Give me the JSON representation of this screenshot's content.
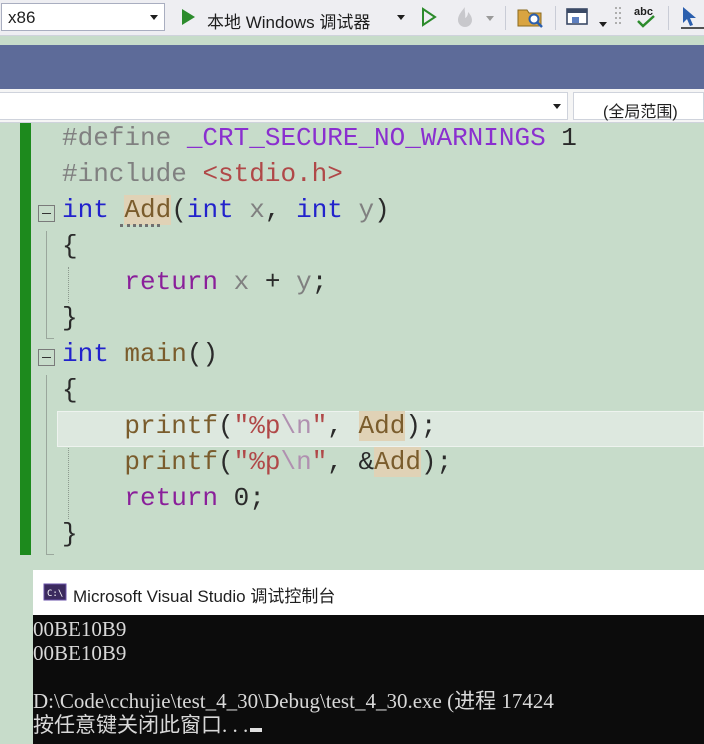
{
  "toolbar": {
    "platform": "x86",
    "run_label": "本地 Windows 调试器",
    "icons": [
      "play-icon",
      "play-outline-icon",
      "hot-reload-icon",
      "folder-search-icon",
      "window-layout-icon",
      "spell-check-icon",
      "pointer-icon"
    ]
  },
  "navbar": {
    "member_scope": "",
    "global_scope": "(全局范围)"
  },
  "editor": {
    "lines": [
      {
        "tokens": [
          {
            "t": "#define ",
            "c": "pp"
          },
          {
            "t": "_CRT_SECURE_NO_WARNINGS",
            "c": "mac"
          },
          {
            "t": " 1",
            "c": "plain"
          }
        ]
      },
      {
        "tokens": [
          {
            "t": "#include ",
            "c": "pp"
          },
          {
            "t": "<stdio.h>",
            "c": "str"
          }
        ]
      },
      {
        "tokens": [
          {
            "t": "int",
            "c": "kw"
          },
          {
            "t": " ",
            "c": "plain"
          },
          {
            "t": "Add",
            "c": "fn hl"
          },
          {
            "t": "(",
            "c": "plain"
          },
          {
            "t": "int",
            "c": "kw"
          },
          {
            "t": " ",
            "c": "plain"
          },
          {
            "t": "x",
            "c": "var"
          },
          {
            "t": ", ",
            "c": "plain"
          },
          {
            "t": "int",
            "c": "kw"
          },
          {
            "t": " ",
            "c": "plain"
          },
          {
            "t": "y",
            "c": "var"
          },
          {
            "t": ")",
            "c": "plain"
          }
        ]
      },
      {
        "tokens": [
          {
            "t": "{",
            "c": "plain"
          }
        ]
      },
      {
        "tokens": [
          {
            "t": "    ",
            "c": "plain"
          },
          {
            "t": "return",
            "c": "ctl"
          },
          {
            "t": " ",
            "c": "plain"
          },
          {
            "t": "x",
            "c": "var"
          },
          {
            "t": " + ",
            "c": "plain"
          },
          {
            "t": "y",
            "c": "var"
          },
          {
            "t": ";",
            "c": "plain"
          }
        ]
      },
      {
        "tokens": [
          {
            "t": "}",
            "c": "plain"
          }
        ]
      },
      {
        "tokens": [
          {
            "t": "int",
            "c": "kw"
          },
          {
            "t": " ",
            "c": "plain"
          },
          {
            "t": "main",
            "c": "fn"
          },
          {
            "t": "()",
            "c": "plain"
          }
        ]
      },
      {
        "tokens": [
          {
            "t": "{",
            "c": "plain"
          }
        ]
      },
      {
        "tokens": [
          {
            "t": "    ",
            "c": "plain"
          },
          {
            "t": "printf",
            "c": "fn"
          },
          {
            "t": "(",
            "c": "plain"
          },
          {
            "t": "\"%p",
            "c": "str"
          },
          {
            "t": "\\n",
            "c": "esc"
          },
          {
            "t": "\"",
            "c": "str"
          },
          {
            "t": ", ",
            "c": "plain"
          },
          {
            "t": "Add",
            "c": "fn hl"
          },
          {
            "t": ");",
            "c": "plain"
          }
        ]
      },
      {
        "tokens": [
          {
            "t": "    ",
            "c": "plain"
          },
          {
            "t": "printf",
            "c": "fn"
          },
          {
            "t": "(",
            "c": "plain"
          },
          {
            "t": "\"%p",
            "c": "str"
          },
          {
            "t": "\\n",
            "c": "esc"
          },
          {
            "t": "\"",
            "c": "str"
          },
          {
            "t": ", &",
            "c": "plain"
          },
          {
            "t": "Add",
            "c": "fn hl"
          },
          {
            "t": ");",
            "c": "plain"
          }
        ]
      },
      {
        "tokens": [
          {
            "t": "    ",
            "c": "plain"
          },
          {
            "t": "return",
            "c": "ctl"
          },
          {
            "t": " 0;",
            "c": "plain"
          }
        ]
      },
      {
        "tokens": [
          {
            "t": "}",
            "c": "plain"
          }
        ]
      }
    ]
  },
  "console": {
    "title": "Microsoft Visual Studio 调试控制台",
    "lines": [
      "00BE10B9",
      "00BE10B9",
      "",
      "D:\\Code\\cchujie\\test_4_30\\Debug\\test_4_30.exe (进程 17424",
      "按任意键关闭此窗口. . ."
    ]
  },
  "colors": {
    "editor_bg": "#c7dcca",
    "title_band": "#5d6b99",
    "change_bar": "#1d8a1d",
    "keyword": "#2222cc",
    "string": "#b04848",
    "macro": "#8a2fcf"
  }
}
